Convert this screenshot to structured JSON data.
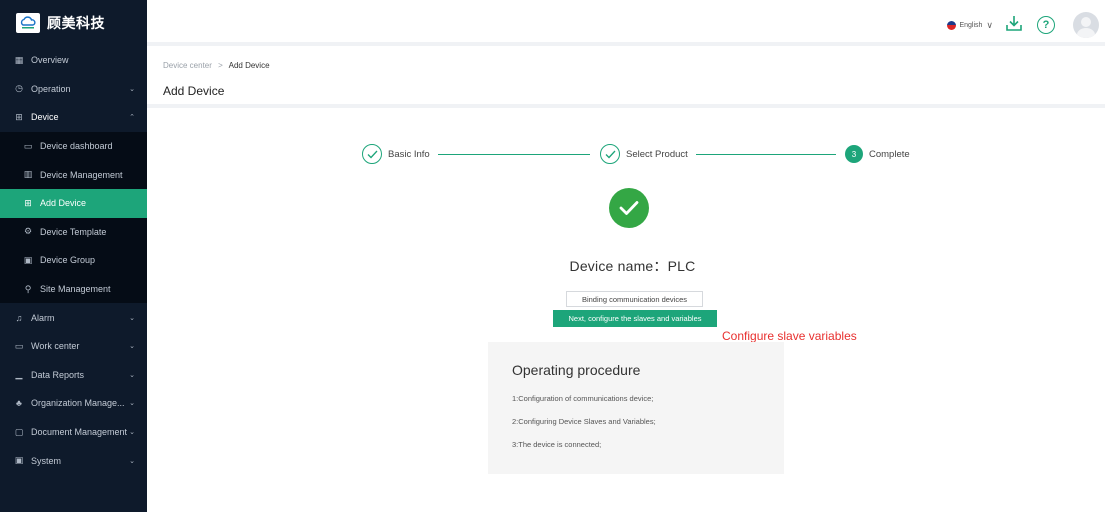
{
  "brand": {
    "name": "顾美科技"
  },
  "sidebar": {
    "items": [
      {
        "label": "Overview",
        "icon": "overview-icon",
        "glyph": "▦",
        "chevron": ""
      },
      {
        "label": "Operation",
        "icon": "operation-icon",
        "glyph": "◷",
        "chevron": "⌄"
      },
      {
        "label": "Device",
        "icon": "device-icon",
        "glyph": "⊞",
        "chevron": "⌃"
      },
      {
        "label": "Device dashboard",
        "icon": "dashboard-icon",
        "glyph": "▭",
        "chevron": "",
        "sub": true
      },
      {
        "label": "Device Management",
        "icon": "management-icon",
        "glyph": "▥",
        "chevron": "",
        "sub": true
      },
      {
        "label": "Add Device",
        "icon": "add-device-icon",
        "glyph": "⊞",
        "chevron": "",
        "sub": true,
        "active": true
      },
      {
        "label": "Device Template",
        "icon": "template-icon",
        "glyph": "⚙",
        "chevron": "",
        "sub": true
      },
      {
        "label": "Device Group",
        "icon": "group-icon",
        "glyph": "▣",
        "chevron": "",
        "sub": true
      },
      {
        "label": "Site Management",
        "icon": "site-icon",
        "glyph": "⚲",
        "chevron": "",
        "sub": true
      },
      {
        "label": "Alarm",
        "icon": "alarm-icon",
        "glyph": "♫",
        "chevron": "⌄"
      },
      {
        "label": "Work center",
        "icon": "work-center-icon",
        "glyph": "▭",
        "chevron": "⌄"
      },
      {
        "label": "Data Reports",
        "icon": "reports-icon",
        "glyph": "▁",
        "chevron": "⌄"
      },
      {
        "label": "Organization Manage...",
        "icon": "organization-icon",
        "glyph": "♣",
        "chevron": "⌄"
      },
      {
        "label": "Document Management",
        "icon": "document-icon",
        "glyph": "▢",
        "chevron": "⌄"
      },
      {
        "label": "System",
        "icon": "system-icon",
        "glyph": "▣",
        "chevron": "⌄"
      }
    ]
  },
  "header": {
    "language": "English"
  },
  "breadcrumb": {
    "parent": "Device center",
    "separator": ">",
    "current": "Add Device"
  },
  "page": {
    "title": "Add Device"
  },
  "steps": [
    {
      "label": "Basic Info",
      "status": "done"
    },
    {
      "label": "Select Product",
      "status": "done"
    },
    {
      "label": "Complete",
      "status": "current",
      "number": "3"
    }
  ],
  "result": {
    "device_name_label": "Device name",
    "device_name_sep": "：",
    "device_name_value": "PLC"
  },
  "buttons": {
    "bind": "Binding communication devices",
    "next": "Next, configure the slaves and variables"
  },
  "annotation": "Configure slave variables",
  "procedure": {
    "title": "Operating procedure",
    "steps": [
      "1:Configuration of communications device;",
      "2:Configuring Device Slaves and Variables;",
      "3:The device is connected;"
    ]
  },
  "colors": {
    "accent": "#1da57a",
    "sidebar_bg": "#0e1a2b",
    "annotation": "#e8302f"
  }
}
